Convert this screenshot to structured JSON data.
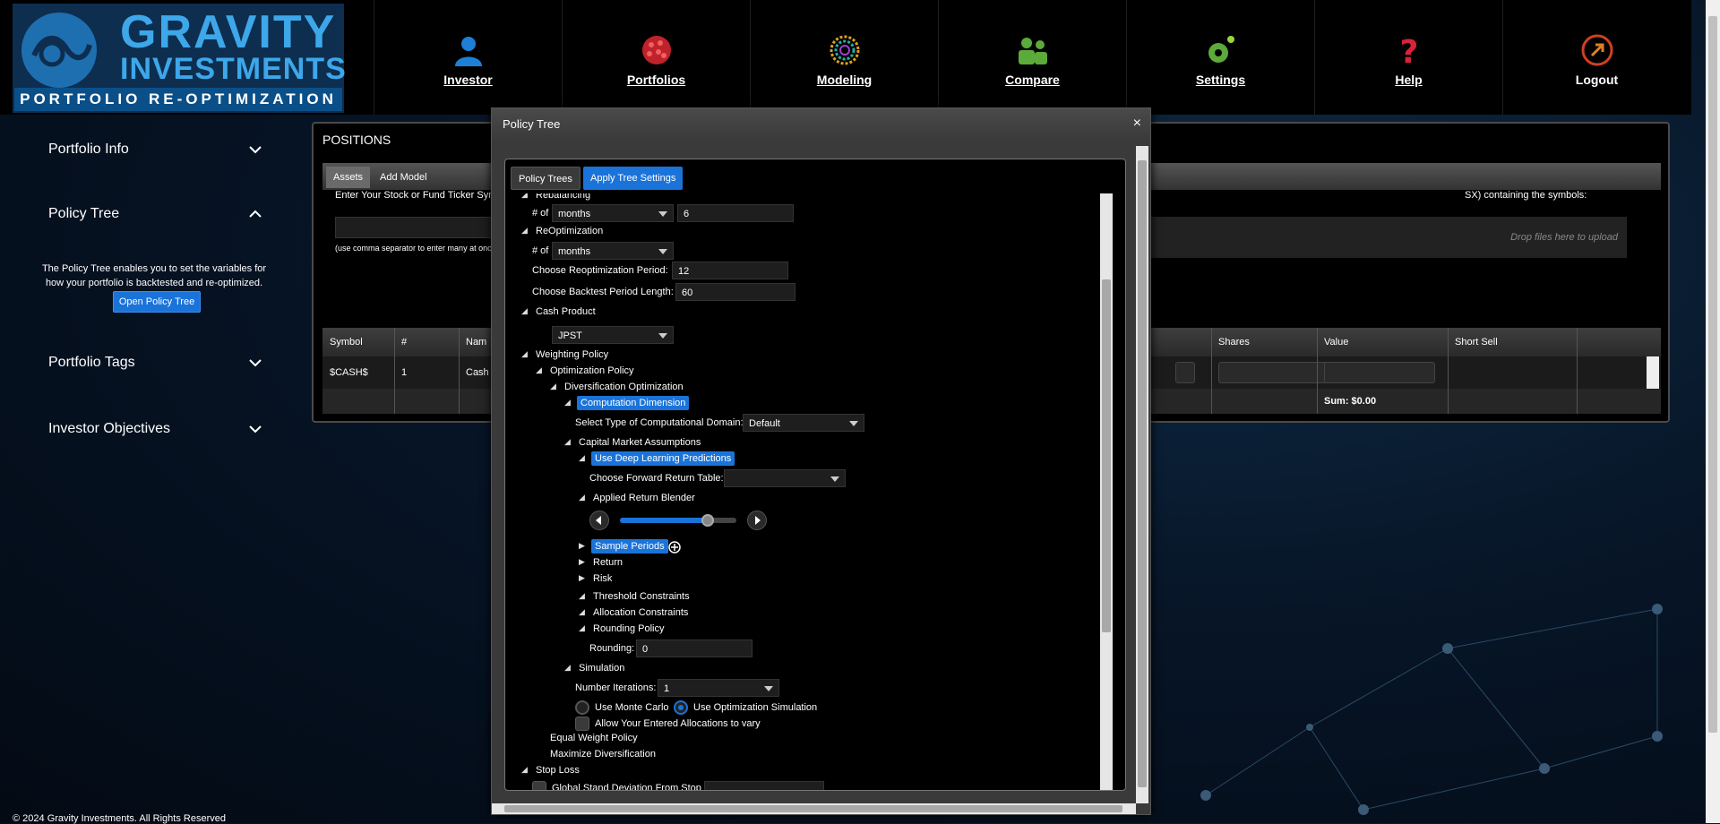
{
  "brand": {
    "line1": "GRAVITY",
    "line2": "INVESTMENTS",
    "tagline": "PORTFOLIO RE-OPTIMIZATION"
  },
  "nav": [
    {
      "label": "Investor",
      "icon": "person-icon"
    },
    {
      "label": "Portfolios",
      "icon": "portfolios-icon"
    },
    {
      "label": "Modeling",
      "icon": "modeling-icon"
    },
    {
      "label": "Compare",
      "icon": "compare-icon"
    },
    {
      "label": "Settings",
      "icon": "gear-icon"
    },
    {
      "label": "Help",
      "icon": "question-icon"
    },
    {
      "label": "Logout",
      "icon": "logout-icon"
    }
  ],
  "sidebar": {
    "sections": [
      {
        "title": "Portfolio Info",
        "expanded": false
      },
      {
        "title": "Policy Tree",
        "expanded": true
      },
      {
        "title": "Portfolio Tags",
        "expanded": false
      },
      {
        "title": "Investor Objectives",
        "expanded": false
      }
    ],
    "policy_desc": "The Policy Tree enables you to set the variables for how your portfolio is backtested and re-optimized.",
    "open_policy_tree": "Open Policy Tree"
  },
  "copyright": "© 2024 Gravity Investments. All Rights Reserved",
  "positions": {
    "title": "POSITIONS",
    "tabs": [
      "Assets",
      "Add Model"
    ],
    "instructions_left": "Enter Your Stock or Fund Ticker Sym",
    "instructions_right": "SX) containing the symbols:",
    "help_small": "(use comma separator to enter many at onc",
    "dropzone": "Drop files here to upload",
    "columns": {
      "symbol": "Symbol",
      "num": "#",
      "name": "Nam",
      "shares": "Shares",
      "value": "Value",
      "short": "Short Sell"
    },
    "row": {
      "symbol": "$CASH$",
      "num": "1",
      "name": "Cash"
    },
    "sum": "Sum: $0.00"
  },
  "dialog": {
    "title": "Policy Tree",
    "close": "×",
    "tabs": [
      "Policy Trees",
      "Apply Tree Settings"
    ],
    "tree": {
      "rebalancing": "Rebalancing",
      "of_label": "# of",
      "rebal_unit": "months",
      "rebal_value": "6",
      "reopt": "ReOptimization",
      "reopt_unit": "months",
      "reopt_period_label": "Choose Reoptimization Period:",
      "reopt_period": "12",
      "backtest_label": "Choose Backtest Period Length:",
      "backtest": "60",
      "cash_product": "Cash Product",
      "cash_value": "JPST",
      "weighting": "Weighting Policy",
      "optimization": "Optimization Policy",
      "diversification": "Diversification Optimization",
      "computation": "Computation Dimension",
      "domain_label": "Select Type of Computational Domain:",
      "domain_value": "Default",
      "cma": "Capital Market Assumptions",
      "deep_learning": "Use Deep Learning Predictions",
      "forward_label": "Choose Forward Return Table:",
      "forward_value": "",
      "blender": "Applied Return Blender",
      "blender_level": 0.75,
      "sample_periods": "Sample Periods",
      "return": "Return",
      "risk": "Risk",
      "threshold": "Threshold Constraints",
      "allocation": "Allocation Constraints",
      "rounding_policy": "Rounding Policy",
      "rounding_label": "Rounding:",
      "rounding_value": "0",
      "simulation": "Simulation",
      "iterations_label": "Number Iterations:",
      "iterations_value": "1",
      "monte_carlo": "Use Monte Carlo",
      "opt_sim": "Use Optimization Simulation",
      "allow_vary": "Allow Your Entered Allocations to vary",
      "equal_weight": "Equal Weight Policy",
      "max_div": "Maximize Diversification",
      "stop_loss": "Stop Loss",
      "global_sd": "Global Stand Deviation From Stop"
    }
  }
}
